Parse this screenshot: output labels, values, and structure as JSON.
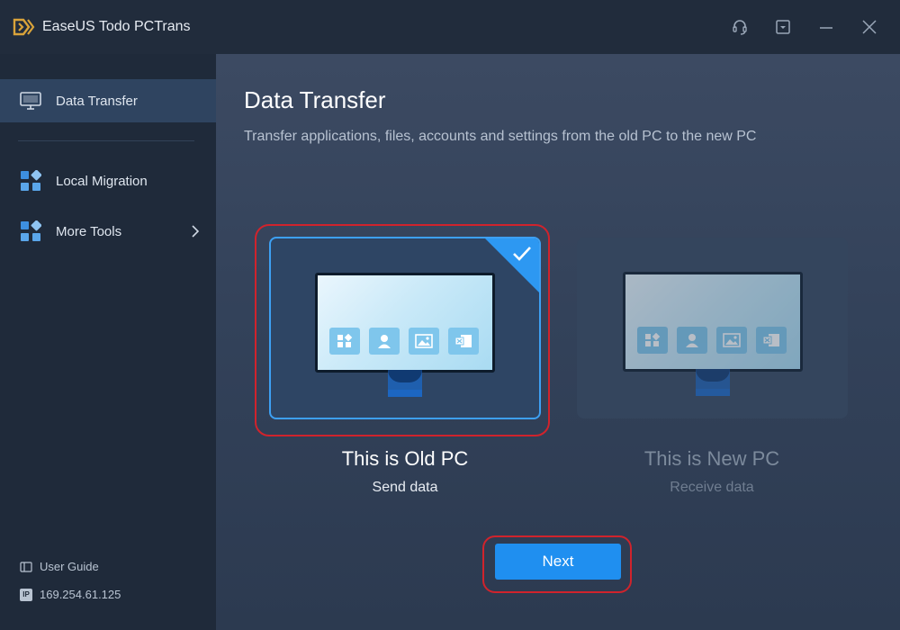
{
  "window": {
    "title": "EaseUS Todo PCTrans",
    "buttons": [
      "headset-icon",
      "menu-dropdown-icon",
      "minimize-icon",
      "close-icon"
    ]
  },
  "sidebar": {
    "items": [
      {
        "label": "Data Transfer",
        "icon": "monitor-icon",
        "active": true
      },
      {
        "label": "Local Migration",
        "icon": "apps-grid-icon",
        "active": false
      },
      {
        "label": "More Tools",
        "icon": "apps-grid-icon",
        "active": false,
        "has_submenu": true
      }
    ],
    "footer": {
      "user_guide": "User Guide",
      "ip_badge": "IP",
      "ip_address": "169.254.61.125"
    }
  },
  "main": {
    "title": "Data Transfer",
    "subtitle": "Transfer applications, files, accounts and settings from the old PC to the new PC",
    "options": [
      {
        "title": "This is Old PC",
        "subtitle": "Send data",
        "selected": true
      },
      {
        "title": "This is New PC",
        "subtitle": "Receive data",
        "selected": false
      }
    ],
    "next_label": "Next"
  },
  "colors": {
    "accent": "#1f8ff0",
    "highlight": "#d0232c",
    "sidebar_bg": "#1f2a3a"
  }
}
